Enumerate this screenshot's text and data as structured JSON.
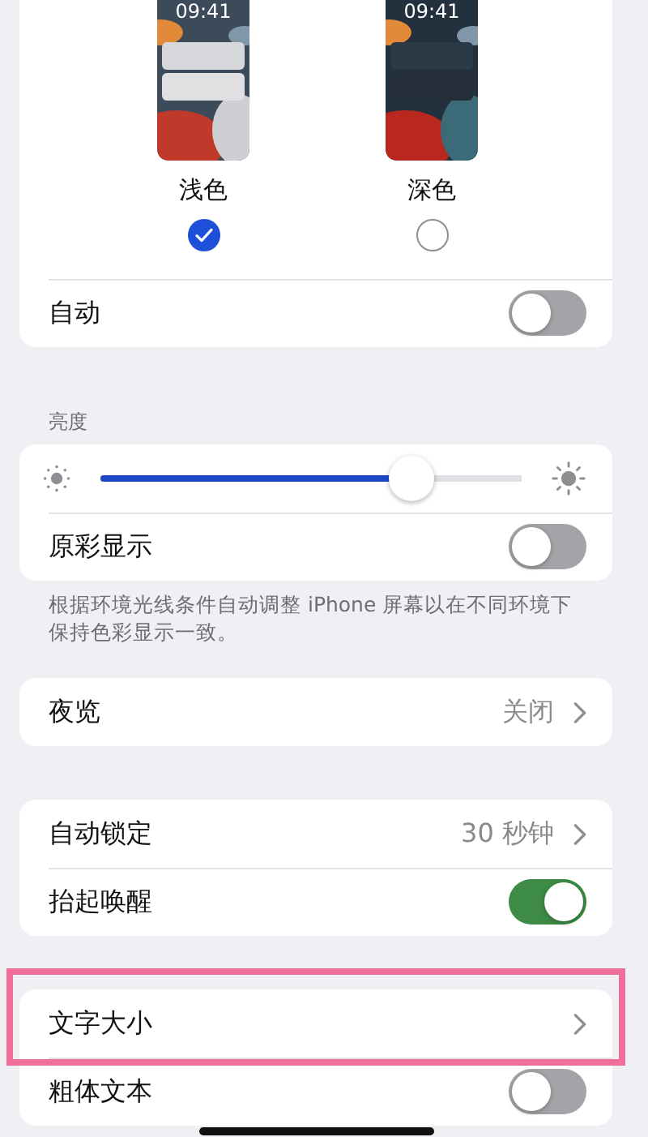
{
  "appearance": {
    "options": [
      {
        "label": "浅色",
        "time": "09:41",
        "kind": "light",
        "selected": true
      },
      {
        "label": "深色",
        "time": "09:41",
        "kind": "dark",
        "selected": false
      }
    ],
    "auto": {
      "label": "自动",
      "on": false
    }
  },
  "groups": [
    {
      "header": "亮度",
      "footer": "根据环境光线条件自动调整 iPhone 屏幕以在不同环境下保持色彩显示一致。",
      "rows": [
        {
          "kind": "slider",
          "level": 0.74
        },
        {
          "kind": "toggle",
          "label": "原彩显示",
          "on": false
        }
      ]
    },
    {
      "rows": [
        {
          "kind": "link",
          "label": "夜览",
          "value": "关闭"
        }
      ]
    },
    {
      "rows": [
        {
          "kind": "link",
          "label": "自动锁定",
          "value": "30 秒钟"
        },
        {
          "kind": "toggle",
          "label": "抬起唤醒",
          "on": true
        }
      ]
    },
    {
      "rows": [
        {
          "kind": "link",
          "label": "文字大小",
          "highlighted": true
        },
        {
          "kind": "toggle",
          "label": "粗体文本",
          "on": false
        }
      ]
    }
  ]
}
